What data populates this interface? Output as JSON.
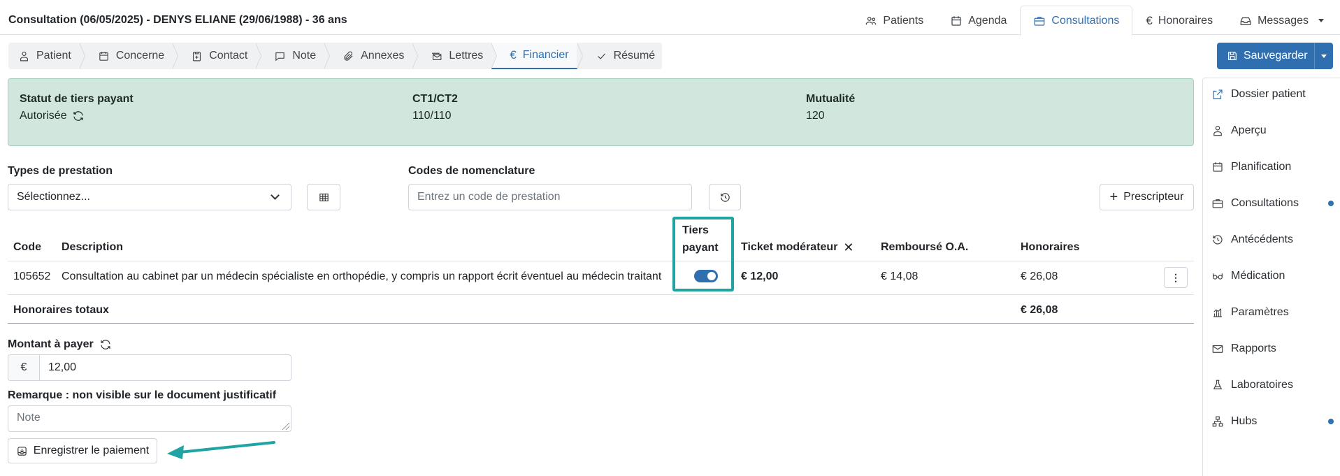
{
  "header": {
    "title": "Consultation (06/05/2025) - DENYS ELIANE (29/06/1988) - 36 ans",
    "nav": [
      {
        "label": "Patients",
        "icon": "users-icon"
      },
      {
        "label": "Agenda",
        "icon": "calendar-icon"
      },
      {
        "label": "Consultations",
        "icon": "briefcase-icon",
        "active": true
      },
      {
        "label": "Honoraires",
        "icon": "euro-icon"
      },
      {
        "label": "Messages",
        "icon": "inbox-icon"
      }
    ]
  },
  "steps": [
    {
      "label": "Patient",
      "icon": "person-icon"
    },
    {
      "label": "Concerne",
      "icon": "calendar-icon"
    },
    {
      "label": "Contact",
      "icon": "clipboard-plus-icon"
    },
    {
      "label": "Note",
      "icon": "chat-icon"
    },
    {
      "label": "Annexes",
      "icon": "paperclip-icon"
    },
    {
      "label": "Lettres",
      "icon": "envelopes-icon"
    },
    {
      "label": "Financier",
      "icon": "euro-icon",
      "active": true
    },
    {
      "label": "Résumé",
      "icon": "check-icon"
    }
  ],
  "toolbar": {
    "save_label": "Sauvegarder"
  },
  "status": {
    "tiers_label": "Statut de tiers payant",
    "tiers_value": "Autorisée",
    "ct_label": "CT1/CT2",
    "ct_value": "110/110",
    "mut_label": "Mutualité",
    "mut_value": "120",
    "panel_color": "#d1e7dd"
  },
  "form": {
    "types_label": "Types de prestation",
    "types_value": "Sélectionnez...",
    "codes_label": "Codes de nomenclature",
    "codes_placeholder": "Entrez un code de prestation",
    "prescripteur_label": "Prescripteur"
  },
  "table": {
    "headers": {
      "code": "Code",
      "description": "Description",
      "tiers_line1": "Tiers",
      "tiers_line2": "payant",
      "ticket": "Ticket modérateur",
      "rembourse": "Remboursé O.A.",
      "honoraires": "Honoraires"
    },
    "rows": [
      {
        "code": "105652",
        "description": "Consultation au cabinet par un médecin spécialiste en orthopédie, y compris un rapport écrit éventuel au médecin traitant",
        "tiers_payant": true,
        "ticket": "€ 12,00",
        "rembourse": "€ 14,08",
        "honoraires": "€ 26,08"
      }
    ],
    "total_label": "Honoraires totaux",
    "total_value": "€ 26,08"
  },
  "payment": {
    "amount_label": "Montant à payer",
    "currency": "€",
    "amount_value": "12,00",
    "remark_label": "Remarque : non visible sur le document justificatif",
    "note_placeholder": "Note",
    "pay_button": "Enregistrer le paiement"
  },
  "sidebar": {
    "items": [
      {
        "label": "Dossier patient",
        "icon": "external-link-icon"
      },
      {
        "label": "Aperçu",
        "icon": "person-icon"
      },
      {
        "label": "Planification",
        "icon": "calendar-icon"
      },
      {
        "label": "Consultations",
        "icon": "briefcase-icon",
        "badge": true
      },
      {
        "label": "Antécédents",
        "icon": "history-icon"
      },
      {
        "label": "Médication",
        "icon": "glasses-icon"
      },
      {
        "label": "Paramètres",
        "icon": "bar-chart-icon"
      },
      {
        "label": "Rapports",
        "icon": "envelope-icon"
      },
      {
        "label": "Laboratoires",
        "icon": "flask-icon"
      },
      {
        "label": "Hubs",
        "icon": "network-icon",
        "badge": true
      }
    ]
  },
  "colors": {
    "accent": "#2f6fb0",
    "highlight": "#1fa3a3"
  }
}
